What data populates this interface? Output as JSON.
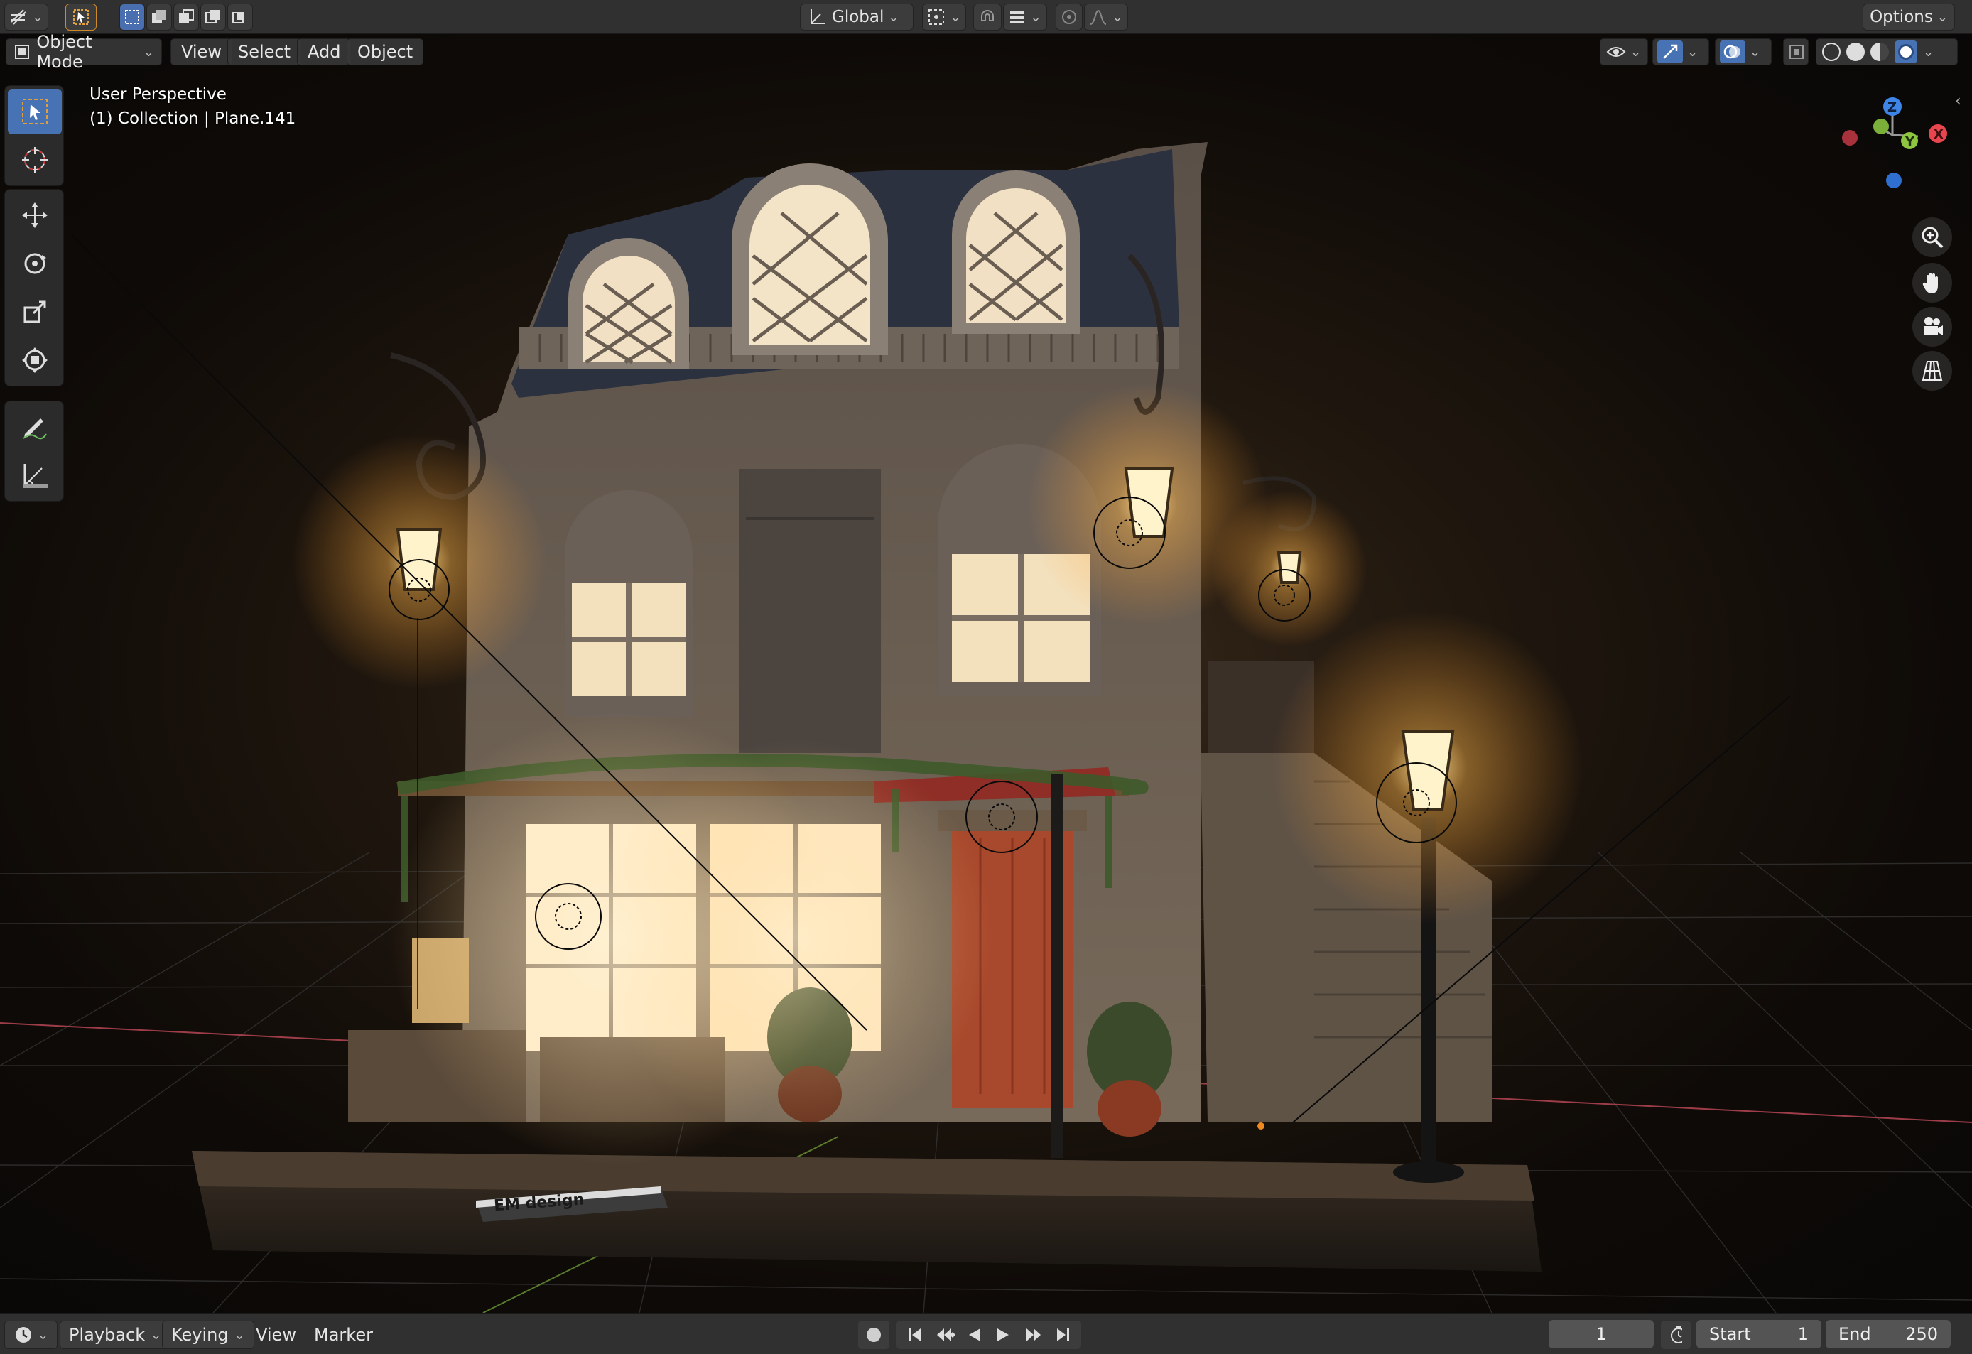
{
  "header": {
    "transform_orientation": "Global",
    "options_label": "Options"
  },
  "viewport_header": {
    "mode": "Object Mode",
    "menus": [
      "View",
      "Select",
      "Add",
      "Object"
    ]
  },
  "overlay": {
    "view_name": "User Perspective",
    "collection_info": "(1) Collection | Plane.141"
  },
  "gizmo": {
    "x": "X",
    "y": "Y",
    "z": "Z"
  },
  "toolbar": {
    "tools": [
      "select-box",
      "cursor",
      "move",
      "rotate",
      "scale",
      "transform",
      "annotate",
      "measure"
    ],
    "active_tool": "select-box"
  },
  "navigation": [
    "zoom-icon",
    "hand-pan-icon",
    "camera-icon",
    "grid-ortho-icon"
  ],
  "scene": {
    "sign_text": "EM design"
  },
  "timeline": {
    "menus": [
      "Playback",
      "Keying",
      "View",
      "Marker"
    ],
    "current_frame": "1",
    "start_label": "Start",
    "start_value": "1",
    "end_label": "End",
    "end_value": "250"
  },
  "colors": {
    "accent": "#4772b3",
    "header_bg": "#303030",
    "lamp_glow": "#ffd98a",
    "door": "#a8482c",
    "axis_x": "#e8454f",
    "axis_y": "#8ec63f",
    "axis_z": "#3d85e6"
  }
}
